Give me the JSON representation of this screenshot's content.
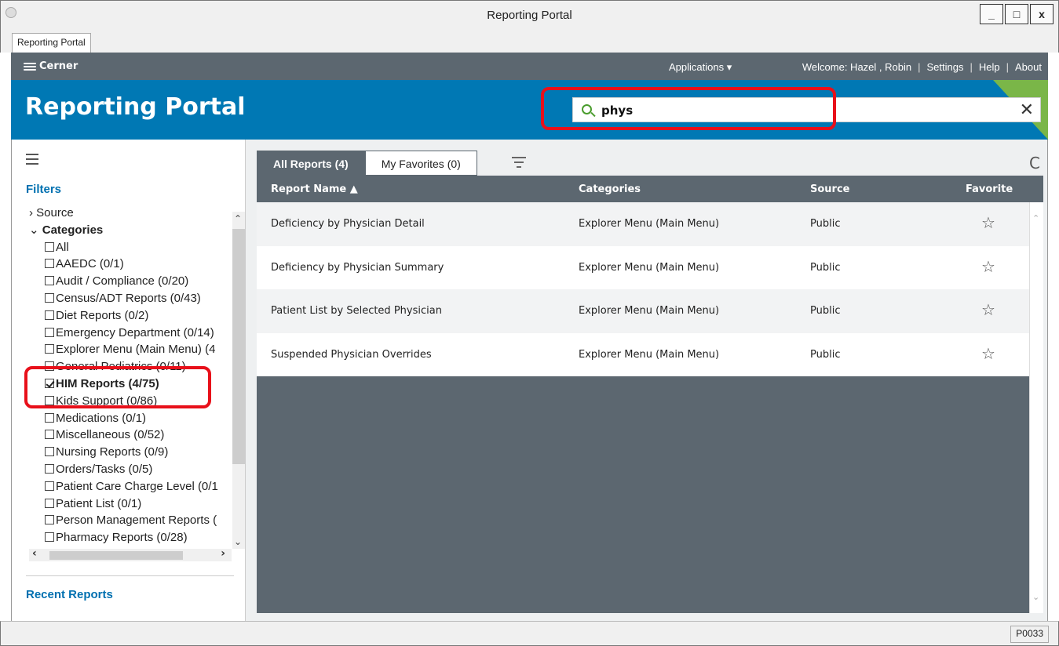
{
  "window": {
    "title": "Reporting Portal",
    "minimize": "_",
    "restore": "□",
    "close": "x",
    "doc_tab": "Reporting Portal"
  },
  "topbar": {
    "brand": "Cerner",
    "applications_label": "Applications ▾",
    "welcome": "Welcome: Hazel , Robin",
    "settings": "Settings",
    "help": "Help",
    "about": "About",
    "separator": "|"
  },
  "header": {
    "title": "Reporting Portal",
    "search_value": "phys",
    "clear_symbol": "✕"
  },
  "sidebar": {
    "filters_heading": "Filters",
    "source_label": "Source",
    "categories_label": "Categories",
    "categories": [
      {
        "label": "All",
        "checked": false
      },
      {
        "label": "AAEDC (0/1)",
        "checked": false
      },
      {
        "label": "Audit / Compliance (0/20)",
        "checked": false
      },
      {
        "label": "Census/ADT Reports (0/43)",
        "checked": false
      },
      {
        "label": "Diet Reports (0/2)",
        "checked": false
      },
      {
        "label": "Emergency Department (0/14)",
        "checked": false
      },
      {
        "label": "Explorer Menu (Main Menu) (4",
        "checked": false
      },
      {
        "label": "General Pediatrics (0/11)",
        "checked": false
      },
      {
        "label": "HIM Reports (4/75)",
        "checked": true
      },
      {
        "label": "Kids Support (0/86)",
        "checked": false
      },
      {
        "label": "Medications (0/1)",
        "checked": false
      },
      {
        "label": "Miscellaneous (0/52)",
        "checked": false
      },
      {
        "label": "Nursing Reports (0/9)",
        "checked": false
      },
      {
        "label": "Orders/Tasks (0/5)",
        "checked": false
      },
      {
        "label": "Patient Care Charge Level (0/1",
        "checked": false
      },
      {
        "label": "Patient List (0/1)",
        "checked": false
      },
      {
        "label": "Person Management Reports (",
        "checked": false
      },
      {
        "label": "Pharmacy Reports (0/28)",
        "checked": false
      }
    ],
    "recent_heading": "Recent Reports"
  },
  "reports": {
    "tabs": [
      {
        "label": "All Reports (4)",
        "active": true
      },
      {
        "label": "My Favorites (0)",
        "active": false
      }
    ],
    "refresh_symbol": "C",
    "columns": {
      "name": "Report Name ▲",
      "categories": "Categories",
      "source": "Source",
      "favorite": "Favorite"
    },
    "rows": [
      {
        "name": "Deficiency by Physician Detail",
        "category": "Explorer Menu (Main Menu)",
        "source": "Public",
        "favorite": "☆"
      },
      {
        "name": "Deficiency by Physician Summary",
        "category": "Explorer Menu (Main Menu)",
        "source": "Public",
        "favorite": "☆"
      },
      {
        "name": "Patient List by Selected Physician",
        "category": "Explorer Menu (Main Menu)",
        "source": "Public",
        "favorite": "☆"
      },
      {
        "name": "Suspended Physician Overrides",
        "category": "Explorer Menu (Main Menu)",
        "source": "Public",
        "favorite": "☆"
      }
    ]
  },
  "status": {
    "code": "P0033"
  },
  "colors": {
    "header_blue": "#0078b4",
    "bar_gray": "#5c6770",
    "highlight_red": "#e8101a",
    "accent_green": "#7ab648"
  }
}
